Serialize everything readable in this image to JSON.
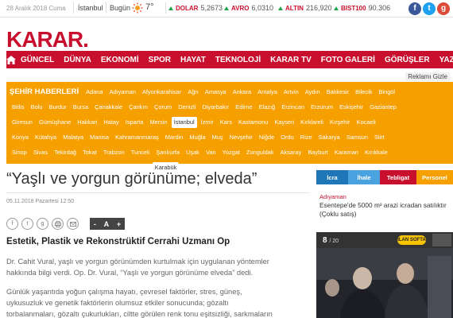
{
  "topbar": {
    "date": "28 Aralık 2018 Cuma",
    "city": "İstanbul",
    "today_label": "Bugün",
    "temperature": "7°",
    "tickers": [
      {
        "label": "DOLAR",
        "value": "5,2673"
      },
      {
        "label": "AVRO",
        "value": "6,0310"
      },
      {
        "label": "ALTIN",
        "value": "216,920"
      },
      {
        "label": "BIST100",
        "value": "90.306"
      }
    ],
    "social": [
      {
        "name": "facebook",
        "glyph": "f",
        "color": "#3b5998"
      },
      {
        "name": "twitter",
        "glyph": "t",
        "color": "#1da1f2"
      },
      {
        "name": "googleplus",
        "glyph": "g",
        "color": "#dd4b39"
      }
    ]
  },
  "logo": {
    "text": "KARAR",
    "dot": "."
  },
  "nav": {
    "items": [
      "GÜNCEL",
      "DÜNYA",
      "EKONOMİ",
      "SPOR",
      "HAYAT",
      "TEKNOLOJİ",
      "KARAR TV",
      "FOTO GALERİ",
      "GÖRÜŞLER",
      "YAZARLAR"
    ]
  },
  "reklam": "Reklamı Gizle",
  "city_news": {
    "title": "ŞEHİR HABERLERİ",
    "active": "İstanbul",
    "rows": [
      [
        "Adana",
        "Adıyaman",
        "Afyonkarahisar",
        "Ağrı",
        "Amasya",
        "Ankara",
        "Antalya",
        "Artvin",
        "Aydın",
        "Balıkesir",
        "Bilecik",
        "Bingöl"
      ],
      [
        "Bitlis",
        "Bolu",
        "Burdur",
        "Bursa",
        "Çanakkale",
        "Çankırı",
        "Çorum",
        "Denizli",
        "Diyarbakır",
        "Edirne",
        "Elazığ",
        "Erzincan",
        "Erzurum",
        "Eskişehir",
        "Gaziantep"
      ],
      [
        "Giresun",
        "Gümüşhane",
        "Hakkari",
        "Hatay",
        "Isparta",
        "Mersin",
        "İstanbul",
        "İzmir",
        "Kars",
        "Kastamonu",
        "Kayseri",
        "Kırklareli",
        "Kırşehir",
        "Kocaeli"
      ],
      [
        "Konya",
        "Kütahya",
        "Malatya",
        "Manisa",
        "Kahramanmaraş",
        "Mardin",
        "Muğla",
        "Muş",
        "Nevşehir",
        "Niğde",
        "Ordu",
        "Rize",
        "Sakarya",
        "Samsun",
        "Siirt"
      ],
      [
        "Sinop",
        "Sivas",
        "Tekirdağ",
        "Tokat",
        "Trabzon",
        "Tunceli",
        "Şanlıurfa",
        "Uşak",
        "Van",
        "Yozgat",
        "Zonguldak",
        "Aksaray",
        "Bayburt",
        "Karaman",
        "Kırıkkale"
      ],
      [
        "Batman",
        "Şırnak",
        "Bartın",
        "Ardahan",
        "Iğdır",
        "Yalova",
        "Karabük",
        "Kilis",
        "Osmaniye",
        "Düzce"
      ]
    ]
  },
  "article": {
    "headline": "“Yaşlı ve yorgun görünüme; elveda”",
    "date": "05.11.2018 Pazartesi 12:50",
    "font_control": {
      "minus": "-",
      "a": "A",
      "plus": "+"
    },
    "subheading": "Estetik, Plastik ve Rekonstrüktif Cerrahi Uzmanı Op",
    "paragraphs": [
      [
        "Dr. Cahit Vural, yaşlı ve yorgun görünümden kurtulmak için uygulanan yöntemler",
        "hakkında bilgi verdi. Op. Dr. Vural, “Yaşlı ve yorgun görünüme elveda” dedi."
      ],
      [
        "Günlük yaşantıda yoğun çalışma hayatı, çevresel faktörler, stres, güneş,",
        "uykusuzluk ve genetik faktörlerin olumsuz etkiler sonucunda; gözaltı",
        "torbalanmaları, gözaltı çukurlukları, ciltte görülen renk tonu eşitsizliği, sarkmaların"
      ]
    ]
  },
  "sidebar": {
    "tabs": [
      {
        "label": "İcra",
        "color": "#1f76b8"
      },
      {
        "label": "İhale",
        "color": "#4aa3df"
      },
      {
        "label": "Tebligat",
        "color": "#c8102e"
      },
      {
        "label": "Personel",
        "color": "#f6a000"
      }
    ],
    "listing": {
      "city": "Adıyaman",
      "text": "Esentepe'de 5000 m² arazi icradan satılıktır (Çoklu satış)"
    },
    "gallery": {
      "current": "8",
      "total": "/ 20",
      "brand": "İLAN SOFTA"
    }
  }
}
